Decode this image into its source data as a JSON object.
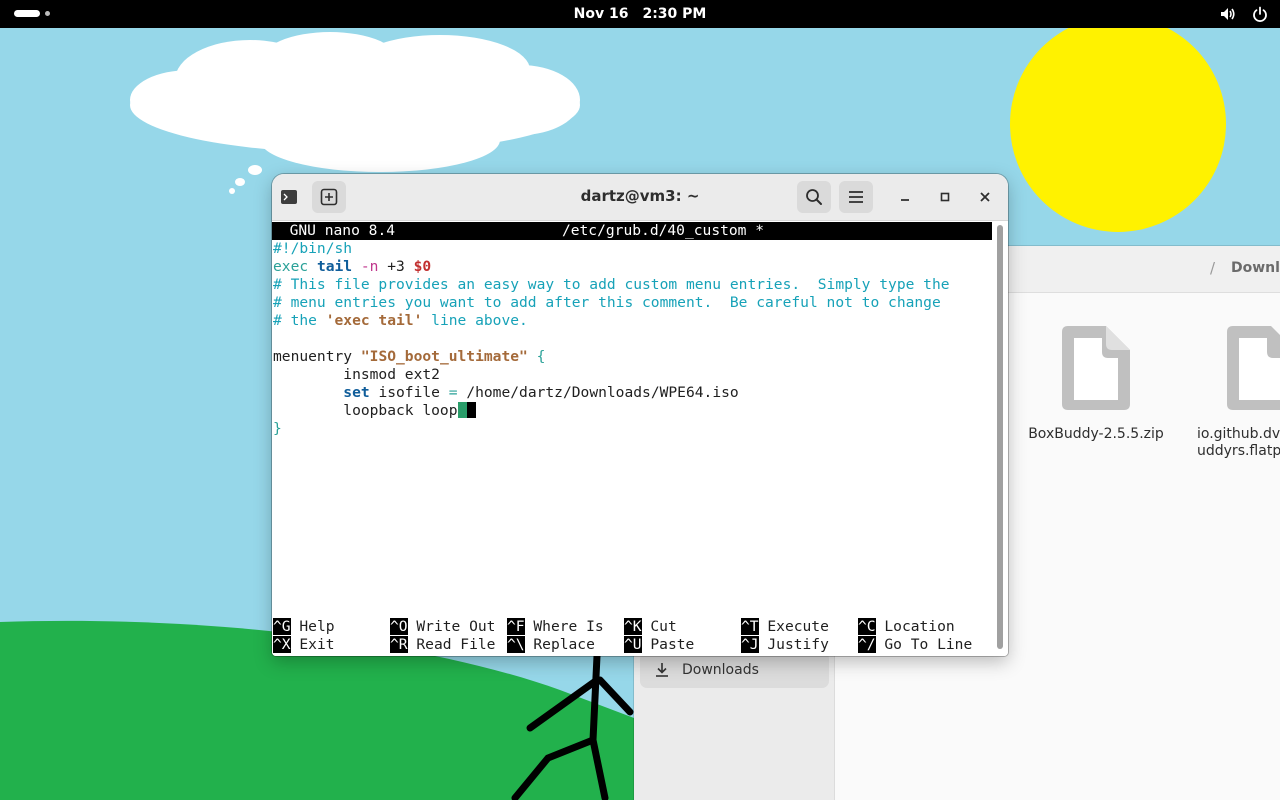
{
  "topbar": {
    "date": "Nov 16",
    "time": "2:30 PM",
    "icons": [
      "activities-indicator",
      "volume-icon",
      "power-icon"
    ]
  },
  "file_manager": {
    "breadcrumb_current": "Downloads",
    "breadcrumb_separator": "/",
    "sidebar": {
      "items": [
        {
          "label": "Downloads",
          "icon": "download-icon",
          "selected": true
        }
      ]
    },
    "files": [
      {
        "name": "BoxBuddy-2.5.5.zip",
        "icon": "file-icon"
      },
      {
        "name_line1": "io.github.dvl",
        "name_line2": "uddyrs.flatp",
        "icon": "file-icon"
      }
    ]
  },
  "terminal": {
    "title": "dartz@vm3: ~",
    "header_icons": [
      "terminal-icon",
      "new-tab-icon",
      "search-icon",
      "menu-icon",
      "minimize-icon",
      "maximize-icon",
      "close-icon"
    ],
    "nano": {
      "version": "GNU nano 8.4",
      "filename": "/etc/grub.d/40_custom *",
      "lines": {
        "l1": "#!/bin/sh",
        "l2": {
          "a": "exec ",
          "b": "tail",
          "c": " ",
          "d": "-n",
          "e": " +3 ",
          "f": "$0"
        },
        "l3": "# This file provides an easy way to add custom menu entries.  Simply type the",
        "l4": "# menu entries you want to add after this comment.  Be careful not to change",
        "l5": {
          "a": "# the ",
          "b": "'exec tail'",
          "c": " line above."
        },
        "l7": {
          "a": "menuentry ",
          "b": "\"ISO_boot_ultimate\"",
          "c": " {"
        },
        "l8": "        insmod ext2",
        "l9": {
          "a": "        ",
          "b": "set",
          "c": " isofile ",
          "d": "=",
          "e": " /home/dartz/Downloads/WPE64.iso"
        },
        "l10": "        loopback loop",
        "l11": "}"
      },
      "shortcuts": [
        {
          "key": "^G",
          "label": "Help"
        },
        {
          "key": "^O",
          "label": "Write Out"
        },
        {
          "key": "^F",
          "label": "Where Is"
        },
        {
          "key": "^K",
          "label": "Cut"
        },
        {
          "key": "^T",
          "label": "Execute"
        },
        {
          "key": "^C",
          "label": "Location"
        },
        {
          "key": "^X",
          "label": "Exit"
        },
        {
          "key": "^R",
          "label": "Read File"
        },
        {
          "key": "^\\",
          "label": "Replace"
        },
        {
          "key": "^U",
          "label": "Paste"
        },
        {
          "key": "^J",
          "label": "Justify"
        },
        {
          "key": "^/",
          "label": "Go To Line"
        }
      ]
    }
  },
  "colors": {
    "sky": "#96d7e9",
    "grass": "#22b14c",
    "sun": "#fff200",
    "comment": "#17a2b8",
    "keyword": "#0f5d9a",
    "string": "#a46a3a",
    "cursor": "#2a9d6a"
  }
}
